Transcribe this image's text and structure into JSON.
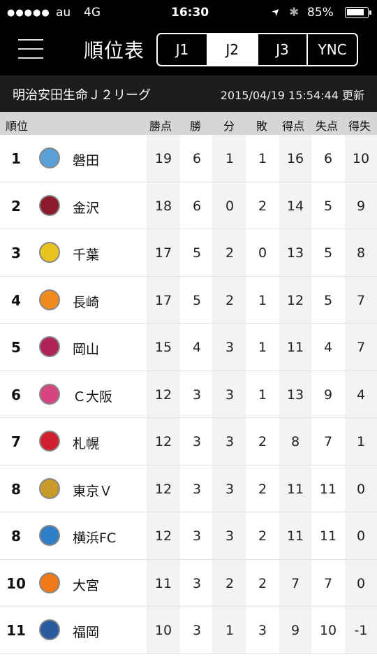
{
  "status_bar": {
    "signal": "●●●●●",
    "carrier": "au",
    "network": "4G",
    "time": "16:30",
    "battery": "85%",
    "location_glyph": "➤",
    "bluetooth_glyph": "✱",
    "battery_icon": "battery-icon"
  },
  "nav": {
    "title": "順位表",
    "tabs": [
      {
        "label": "J1"
      },
      {
        "label": "J2",
        "active": true
      },
      {
        "label": "J3"
      },
      {
        "label": "YNC"
      }
    ]
  },
  "subheader": {
    "league": "明治安田生命Ｊ２リーグ",
    "updated": "2015/04/19 15:54:44 更新"
  },
  "columns": {
    "rank": "順位",
    "points": "勝点",
    "wins": "勝",
    "draws": "分",
    "losses": "敗",
    "goals_for": "得点",
    "goals_against": "失点",
    "goal_diff": "得失"
  },
  "standings": [
    {
      "rank": "1",
      "team": "磐田",
      "points": "19",
      "wins": "6",
      "draws": "1",
      "losses": "1",
      "gf": "16",
      "ga": "6",
      "gd": "10",
      "emblem_color": "#5aa0d8"
    },
    {
      "rank": "2",
      "team": "金沢",
      "points": "18",
      "wins": "6",
      "draws": "0",
      "losses": "2",
      "gf": "14",
      "ga": "5",
      "gd": "9",
      "emblem_color": "#8b1a2b"
    },
    {
      "rank": "3",
      "team": "千葉",
      "points": "17",
      "wins": "5",
      "draws": "2",
      "losses": "0",
      "gf": "13",
      "ga": "5",
      "gd": "8",
      "emblem_color": "#e8c21e"
    },
    {
      "rank": "4",
      "team": "長崎",
      "points": "17",
      "wins": "5",
      "draws": "2",
      "losses": "1",
      "gf": "12",
      "ga": "5",
      "gd": "7",
      "emblem_color": "#f08a1c"
    },
    {
      "rank": "5",
      "team": "岡山",
      "points": "15",
      "wins": "4",
      "draws": "3",
      "losses": "1",
      "gf": "11",
      "ga": "4",
      "gd": "7",
      "emblem_color": "#b0245a"
    },
    {
      "rank": "6",
      "team": "Ｃ大阪",
      "points": "12",
      "wins": "3",
      "draws": "3",
      "losses": "1",
      "gf": "13",
      "ga": "9",
      "gd": "4",
      "emblem_color": "#d6457f"
    },
    {
      "rank": "7",
      "team": "札幌",
      "points": "12",
      "wins": "3",
      "draws": "3",
      "losses": "2",
      "gf": "8",
      "ga": "7",
      "gd": "1",
      "emblem_color": "#cf2030"
    },
    {
      "rank": "8",
      "team": "東京Ｖ",
      "points": "12",
      "wins": "3",
      "draws": "3",
      "losses": "2",
      "gf": "11",
      "ga": "11",
      "gd": "0",
      "emblem_color": "#c79a2a"
    },
    {
      "rank": "8",
      "team": "横浜FC",
      "points": "12",
      "wins": "3",
      "draws": "3",
      "losses": "2",
      "gf": "11",
      "ga": "11",
      "gd": "0",
      "emblem_color": "#2f7fc8"
    },
    {
      "rank": "10",
      "team": "大宮",
      "points": "11",
      "wins": "3",
      "draws": "2",
      "losses": "2",
      "gf": "7",
      "ga": "7",
      "gd": "0",
      "emblem_color": "#f07a1a"
    },
    {
      "rank": "11",
      "team": "福岡",
      "points": "10",
      "wins": "3",
      "draws": "1",
      "losses": "3",
      "gf": "9",
      "ga": "10",
      "gd": "-1",
      "emblem_color": "#2a5aa0"
    }
  ]
}
